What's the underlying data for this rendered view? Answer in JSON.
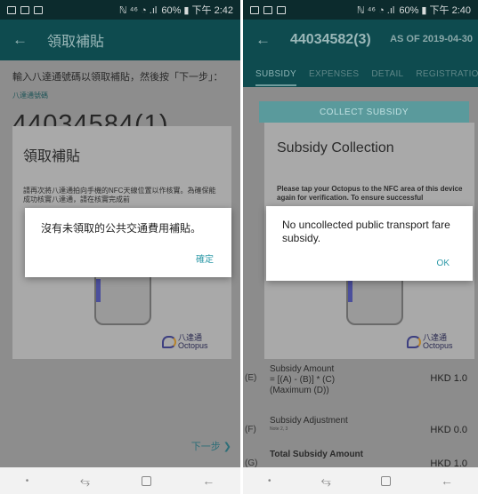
{
  "left": {
    "status": {
      "right": "60% ▮ 下午 2:42",
      "signal": "ℕ ⁴⁶ ◔ .ıl"
    },
    "appbar": {
      "title": "領取補貼"
    },
    "instruction": "輸入八達通號碼以領取補貼，然後按「下一步」：",
    "field_label": "八達通號碼",
    "card_number": "44034584(1)",
    "next_label": "下一步",
    "sheet": {
      "title": "領取補貼",
      "text": "請再次將八達通拍向手機的NFC天線位置以作核實。為確保能成功核實八達通，請在核實完成前"
    },
    "dialog": {
      "message": "沒有未領取的公共交通費用補貼。",
      "ok": "確定"
    },
    "logo": {
      "zh": "八達通",
      "en": "Octopus"
    }
  },
  "right": {
    "status": {
      "right": "60% ▮ 下午 2:40",
      "signal": "ℕ ⁴⁶ ◔ .ıl"
    },
    "appbar": {
      "title": "44034582(3)",
      "as_of": "AS OF 2019-04-30"
    },
    "tabs": [
      "SUBSIDY",
      "EXPENSES",
      "DETAIL",
      "REGISTRATION"
    ],
    "collect_button": "COLLECT SUBSIDY",
    "sheet": {
      "title": "Subsidy Collection",
      "text": "Please tap your Octopus to the NFC area of this device again for verification. To ensure successful"
    },
    "dialog": {
      "message": "No uncollected public transport fare subsidy.",
      "ok": "OK"
    },
    "logo": {
      "zh": "八達通",
      "en": "Octopus"
    },
    "rows": [
      {
        "letter": "(E)",
        "label": "Subsidy Amount",
        "label2": "= [(A) - (B)] * (C)",
        "label3": "(Maximum (D))",
        "value": "HKD 1.0"
      },
      {
        "letter": "(F)",
        "label": "Subsidy Adjustment",
        "note": "Note 2, 3",
        "value": "HKD 0.0"
      },
      {
        "letter": "(G)",
        "label": "Total Subsidy Amount",
        "value": "HKD 1.0"
      }
    ]
  }
}
